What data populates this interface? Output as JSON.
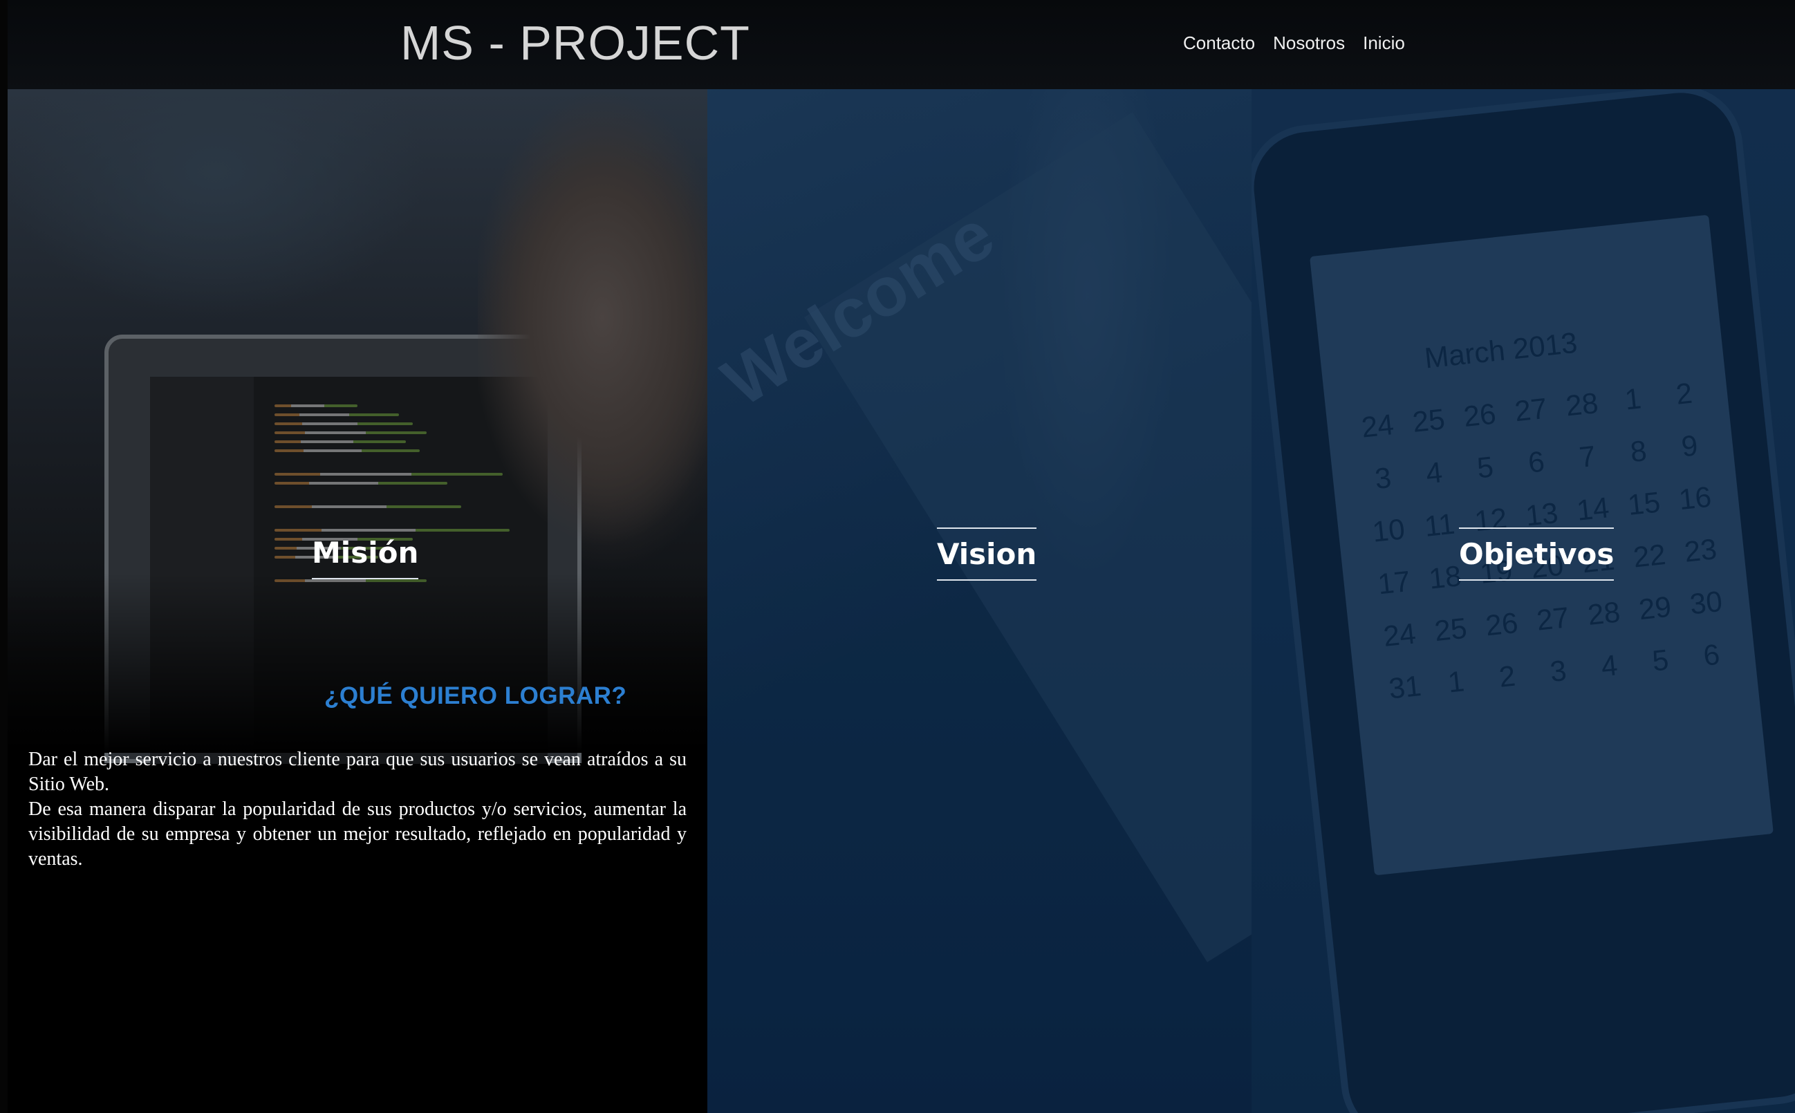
{
  "header": {
    "brand": "MS - PROJECT",
    "nav": [
      {
        "label": "Contacto"
      },
      {
        "label": "Nosotros"
      },
      {
        "label": "Inicio"
      }
    ]
  },
  "panels": {
    "mision": {
      "title": "Misión",
      "subheading": "¿QUÉ QUIERO LOGRAR?",
      "paragraph_1": "Dar el mejor servicio a nuestros cliente para que sus usuarios se vean atraídos a su Sitio Web.",
      "paragraph_2": "De esa manera disparar la popularidad de sus productos y/o servicios, aumentar la visibilidad de su empresa y obtener un mejor resultado, reflejado en popularidad y ventas."
    },
    "vision": {
      "title": "Vision",
      "photo_text": "Welcome"
    },
    "objetivos": {
      "title": "Objetivos",
      "calendar_title": "March 2013"
    }
  },
  "colors": {
    "header_bg": "#0a0c10",
    "brand": "#d6d6d6",
    "accent_blue": "#2c7fd1",
    "panel_blue": "#0c2540"
  }
}
